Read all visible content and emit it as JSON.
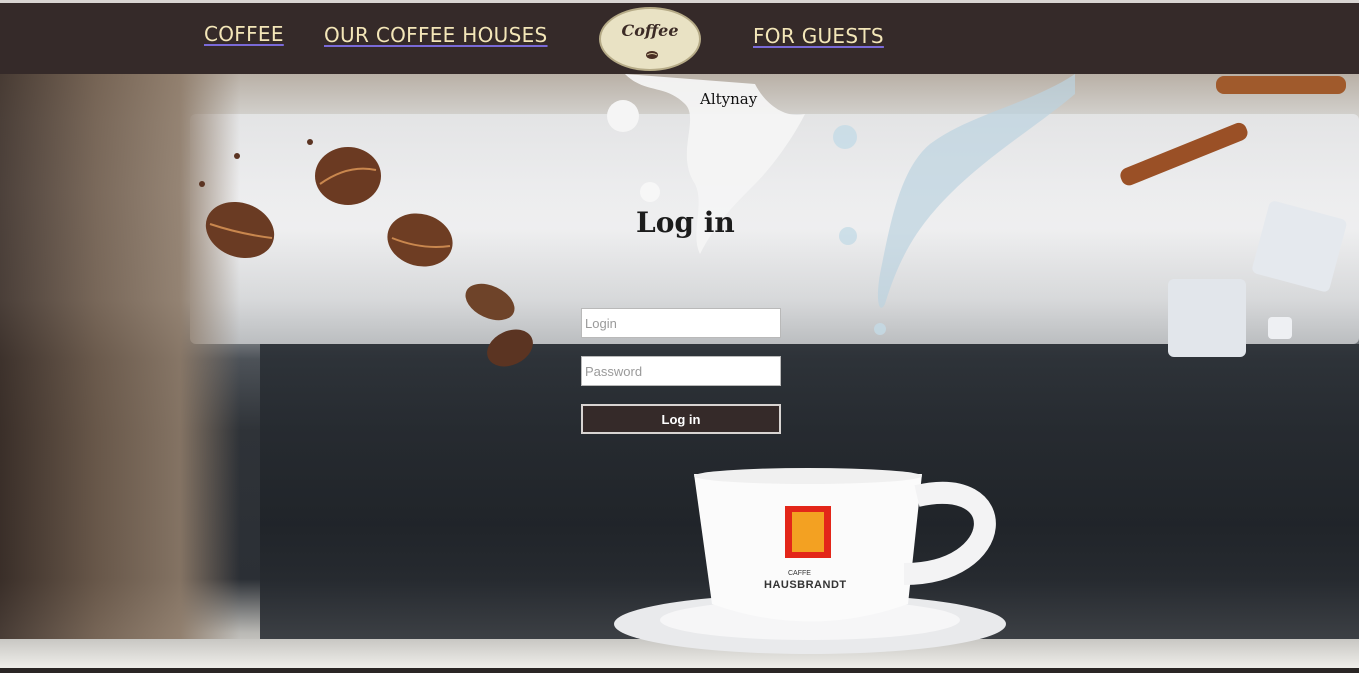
{
  "nav": {
    "links": [
      "COFFEE",
      "OUR COFFEE HOUSES",
      "FOR GUESTS"
    ],
    "logo_text": "Coffee"
  },
  "user": {
    "name": "Altynay"
  },
  "login": {
    "title": "Log in",
    "login_placeholder": "Login",
    "password_placeholder": "Password",
    "button_label": "Log in"
  },
  "cup": {
    "brand_small": "CAFFE",
    "brand": "HAUSBRANDT"
  },
  "icons": [
    "coffee-bean-icon",
    "logo-bean-icon"
  ],
  "colors": {
    "navbar": "#352a29",
    "nav_text": "#f3e6b8",
    "button": "#352a29"
  }
}
